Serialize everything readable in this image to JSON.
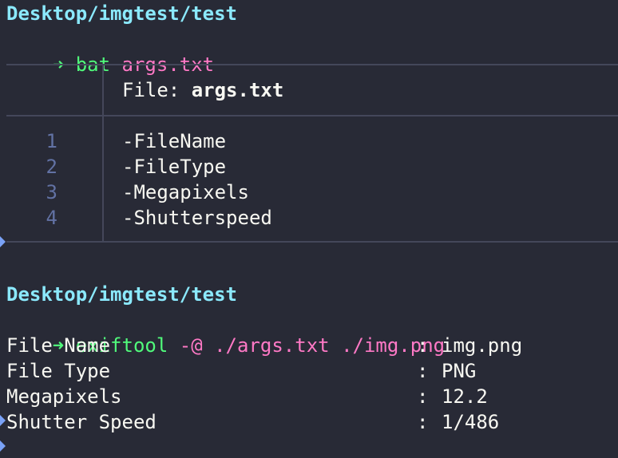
{
  "prompt1": {
    "path": "Desktop/imgtest/test",
    "arrow": "➜",
    "command": "bat",
    "argument": "args.txt"
  },
  "bat": {
    "file_label": "File: ",
    "file_name": "args.txt",
    "lines": [
      {
        "number": "1",
        "text": "-FileName"
      },
      {
        "number": "2",
        "text": "-FileType"
      },
      {
        "number": "3",
        "text": "-Megapixels"
      },
      {
        "number": "4",
        "text": "-Shutterspeed"
      }
    ]
  },
  "prompt2": {
    "path": "Desktop/imgtest/test",
    "arrow": "➜",
    "command": "exiftool",
    "flag": "-@",
    "arg1": "./args.txt",
    "arg2": "./img.png"
  },
  "exif_output": [
    {
      "label": "File Name",
      "sep": ":",
      "value": "img.png"
    },
    {
      "label": "File Type",
      "sep": ":",
      "value": "PNG"
    },
    {
      "label": "Megapixels",
      "sep": ":",
      "value": "12.2"
    },
    {
      "label": "Shutter Speed",
      "sep": ":",
      "value": "1/486"
    }
  ],
  "colors": {
    "background": "#282a36",
    "path": "#8be9fd",
    "command": "#50fa7b",
    "argument": "#ff79c6",
    "line_numbers": "#6272a4",
    "grid": "#44475a",
    "prompt_marker": "#7aa2f7"
  }
}
